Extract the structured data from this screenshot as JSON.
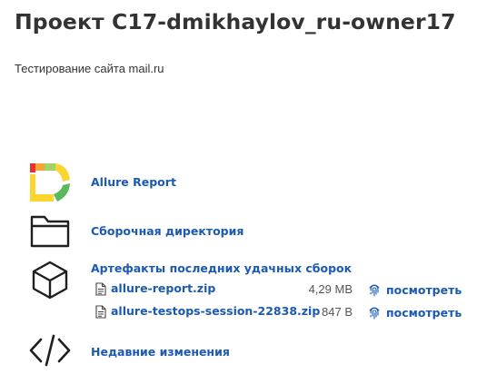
{
  "project": {
    "title": "Проект C17-dmikhaylov_ru-owner17",
    "description": "Тестирование сайта mail.ru"
  },
  "sections": {
    "allure": {
      "label": "Allure Report",
      "icon": "allure-logo"
    },
    "build_dir": {
      "label": "Сборочная директория",
      "icon": "folder-icon"
    },
    "artifacts": {
      "label": "Артефакты последних удачных сборок",
      "icon": "box-icon",
      "files": [
        {
          "name": "allure-report.zip",
          "size": "4,29 MB",
          "view_label": "посмотреть"
        },
        {
          "name": "allure-testops-session-22838.zip",
          "size": "847 B",
          "view_label": "посмотреть"
        }
      ]
    },
    "changes": {
      "label": "Недавние изменения",
      "icon": "code-icon"
    }
  },
  "colors": {
    "link": "#1a5ab2",
    "text": "#333333",
    "allure_red": "#e8332a",
    "allure_yellow": "#fbd630",
    "allure_green": "#5cb85c",
    "allure_lightgreen": "#a0d468"
  }
}
